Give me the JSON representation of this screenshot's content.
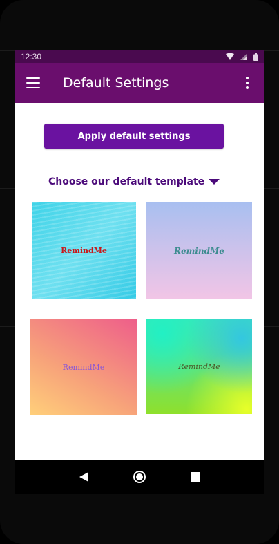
{
  "status_bar": {
    "time": "12:30",
    "icons": [
      "wifi-icon",
      "signal-icon",
      "battery-icon"
    ]
  },
  "app_bar": {
    "title": "Default Settings",
    "menu_icon": "menu-icon",
    "overflow_icon": "overflow-menu-icon"
  },
  "main": {
    "apply_button_label": "Apply default settings",
    "dropdown_label": "Choose our default template",
    "templates": [
      {
        "label": "RemindMe"
      },
      {
        "label": "RemindMe"
      },
      {
        "label": "RemindMe"
      },
      {
        "label": "RemindMe"
      }
    ]
  },
  "nav_bar": {
    "icons": [
      "back-icon",
      "home-icon",
      "recents-icon"
    ]
  },
  "colors": {
    "app_bar": "#6a0e6d",
    "status_bar": "#4a0a4f",
    "button": "#6a12a0",
    "dropdown_text": "#4b0a7a"
  }
}
